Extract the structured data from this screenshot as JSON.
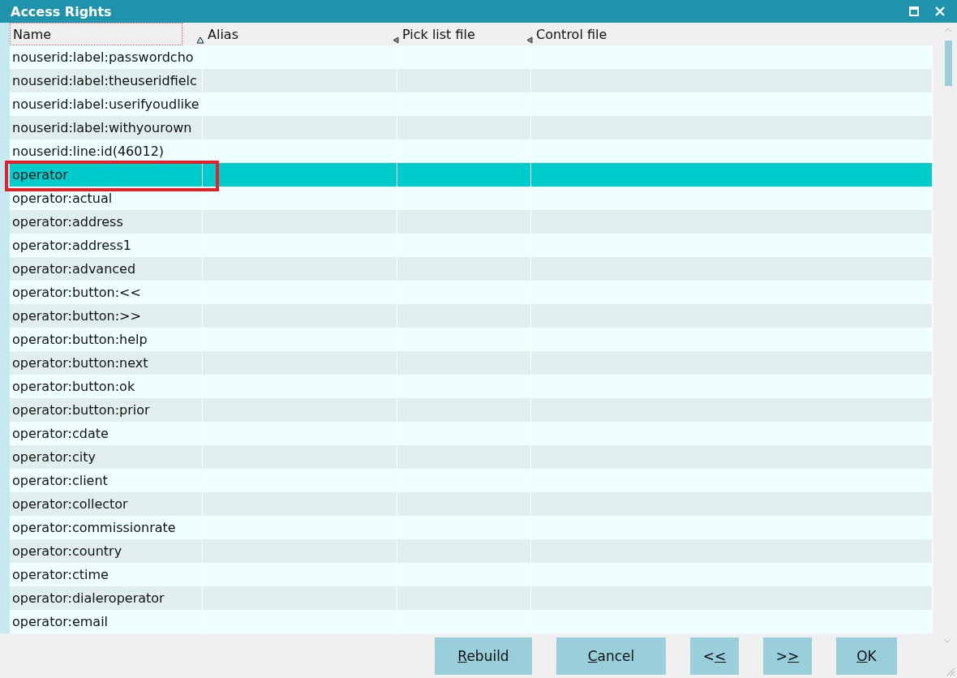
{
  "window": {
    "title": "Access Rights"
  },
  "table": {
    "columns": [
      {
        "label": "Name",
        "focused": true
      },
      {
        "label": "Alias",
        "ascending": true,
        "focused": false
      },
      {
        "label": "Pick list file",
        "ascending": false,
        "focused": false
      },
      {
        "label": "Control file",
        "ascending": false,
        "focused": false
      }
    ],
    "rows": [
      {
        "name": "nouserid:label:passwordcho",
        "selected": false,
        "highlighted": false
      },
      {
        "name": "nouserid:label:theuseridfielc",
        "selected": false,
        "highlighted": false
      },
      {
        "name": "nouserid:label:userifyoudlike",
        "selected": false,
        "highlighted": false
      },
      {
        "name": "nouserid:label:withyourown",
        "selected": false,
        "highlighted": false
      },
      {
        "name": "nouserid:line:id(46012)",
        "selected": false,
        "highlighted": false
      },
      {
        "name": "operator",
        "selected": true,
        "highlighted": true
      },
      {
        "name": "operator:actual",
        "selected": false,
        "highlighted": false
      },
      {
        "name": "operator:address",
        "selected": false,
        "highlighted": false
      },
      {
        "name": "operator:address1",
        "selected": false,
        "highlighted": false
      },
      {
        "name": "operator:advanced",
        "selected": false,
        "highlighted": false
      },
      {
        "name": "operator:button:<<",
        "selected": false,
        "highlighted": false
      },
      {
        "name": "operator:button:>>",
        "selected": false,
        "highlighted": false
      },
      {
        "name": "operator:button:help",
        "selected": false,
        "highlighted": false
      },
      {
        "name": "operator:button:next",
        "selected": false,
        "highlighted": false
      },
      {
        "name": "operator:button:ok",
        "selected": false,
        "highlighted": false
      },
      {
        "name": "operator:button:prior",
        "selected": false,
        "highlighted": false
      },
      {
        "name": "operator:cdate",
        "selected": false,
        "highlighted": false
      },
      {
        "name": "operator:city",
        "selected": false,
        "highlighted": false
      },
      {
        "name": "operator:client",
        "selected": false,
        "highlighted": false
      },
      {
        "name": "operator:collector",
        "selected": false,
        "highlighted": false
      },
      {
        "name": "operator:commissionrate",
        "selected": false,
        "highlighted": false
      },
      {
        "name": "operator:country",
        "selected": false,
        "highlighted": false
      },
      {
        "name": "operator:ctime",
        "selected": false,
        "highlighted": false
      },
      {
        "name": "operator:dialeroperator",
        "selected": false,
        "highlighted": false
      },
      {
        "name": "operator:email",
        "selected": false,
        "highlighted": false
      }
    ]
  },
  "buttons": [
    {
      "key": "R",
      "post": "ebuild"
    },
    {
      "key": "C",
      "post": "ancel"
    },
    {
      "pre": "<",
      "key": "<"
    },
    {
      "pre": ">",
      "key": ">"
    },
    {
      "key": "O",
      "post": "K"
    }
  ]
}
